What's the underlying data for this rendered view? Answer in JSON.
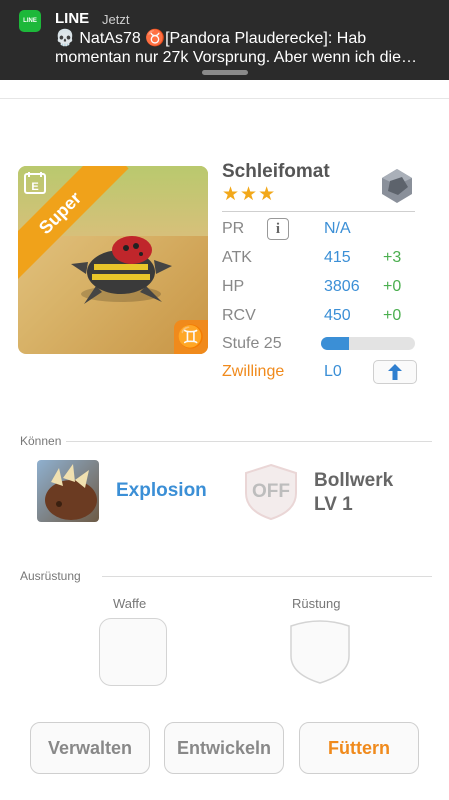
{
  "notification": {
    "app_name": "LINE",
    "time": "Jetzt",
    "line1": "💀 NatAs78  ♉[Pandora Plauderecke]: Hab",
    "line2": "momentan nur 27k Vorsprung. Aber wenn ich die…",
    "icon_text": "LINE"
  },
  "monster": {
    "card_tag": "Super",
    "name": "Schleifomat",
    "stars": "★★★",
    "stats": [
      {
        "label": "PR",
        "value": "N/A",
        "bonus": ""
      },
      {
        "label": "ATK",
        "value": "415",
        "bonus": "+3"
      },
      {
        "label": "HP",
        "value": "3806",
        "bonus": "+0"
      },
      {
        "label": "RCV",
        "value": "450",
        "bonus": "+0"
      }
    ],
    "level_label": "Stufe 25",
    "level_progress": 0.3,
    "twin_label": "Zwillinge",
    "twin_value": "L0",
    "zodiac_symbol": "♊",
    "element_icon": "rock-element-icon"
  },
  "skills": {
    "section_label": "Können",
    "skill_name": "Explosion",
    "passive_state": "OFF",
    "passive_name": "Bollwerk",
    "passive_level": "LV 1"
  },
  "equipment": {
    "section_label": "Ausrüstung",
    "weapon_label": "Waffe",
    "armor_label": "Rüstung"
  },
  "actions": {
    "manage": "Verwalten",
    "evolve": "Entwickeln",
    "feed": "Füttern"
  },
  "colors": {
    "accent_blue": "#3b8fd6",
    "accent_orange": "#f08a1c",
    "bonus_green": "#4caf50",
    "star_gold": "#f2a81a"
  }
}
